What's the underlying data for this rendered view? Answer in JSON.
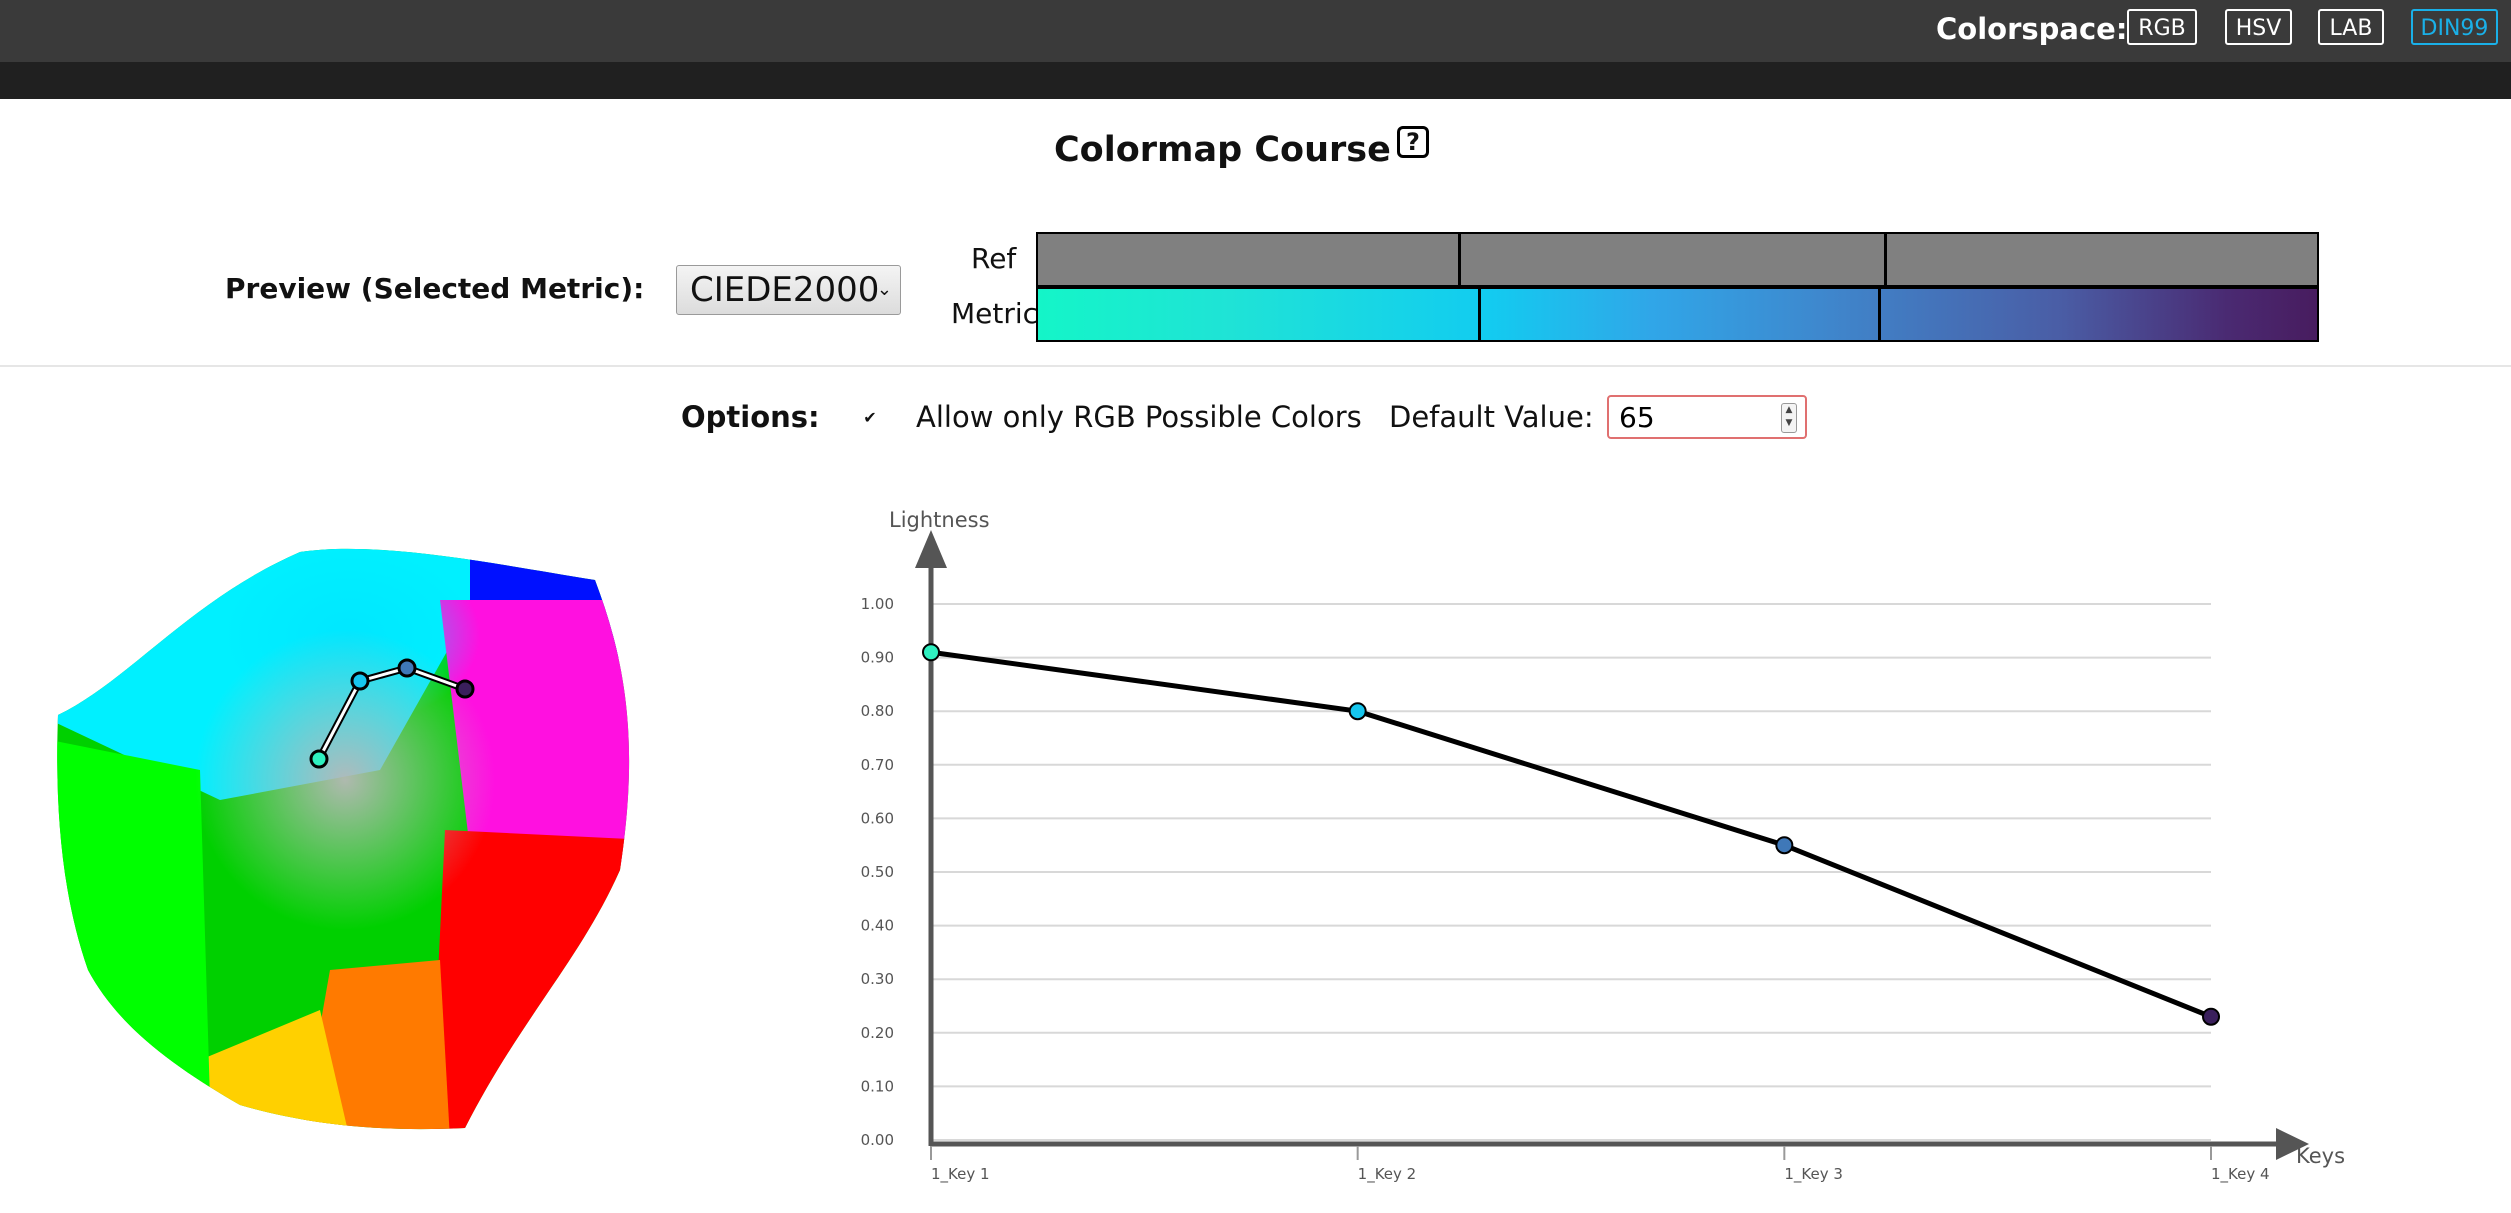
{
  "header": {
    "colorspace_label": "Colorspace:",
    "buttons": [
      {
        "label": "RGB",
        "active": false
      },
      {
        "label": "HSV",
        "active": false
      },
      {
        "label": "LAB",
        "active": false
      },
      {
        "label": "DIN99",
        "active": true
      }
    ],
    "active_color": "#1ab0e8"
  },
  "page": {
    "title": "Colormap Course",
    "help_label": "?"
  },
  "preview": {
    "label": "Preview (Selected Metric):",
    "metric_selected": "CIEDE2000",
    "ref_label": "Ref",
    "metric_label": "Metric"
  },
  "options": {
    "label": "Options:",
    "allow_rgb_checked": true,
    "allow_rgb_label": "Allow only RGB Possible Colors",
    "default_value_label": "Default Value:",
    "default_value": "65"
  },
  "chart_data": {
    "type": "line",
    "ylabel": "Lightness",
    "xlabel": "Keys",
    "ylim": [
      0,
      1
    ],
    "yticks": [
      "0.00",
      "0.10",
      "0.20",
      "0.30",
      "0.40",
      "0.50",
      "0.60",
      "0.70",
      "0.80",
      "0.90",
      "1.00"
    ],
    "categories": [
      "1_Key 1",
      "1_Key 2",
      "1_Key 3",
      "1_Key 4"
    ],
    "values": [
      0.91,
      0.8,
      0.55,
      0.23
    ],
    "point_colors": [
      "#2ff0c0",
      "#16c6ee",
      "#3f78b8",
      "#3a1f5c"
    ],
    "grid": true
  }
}
